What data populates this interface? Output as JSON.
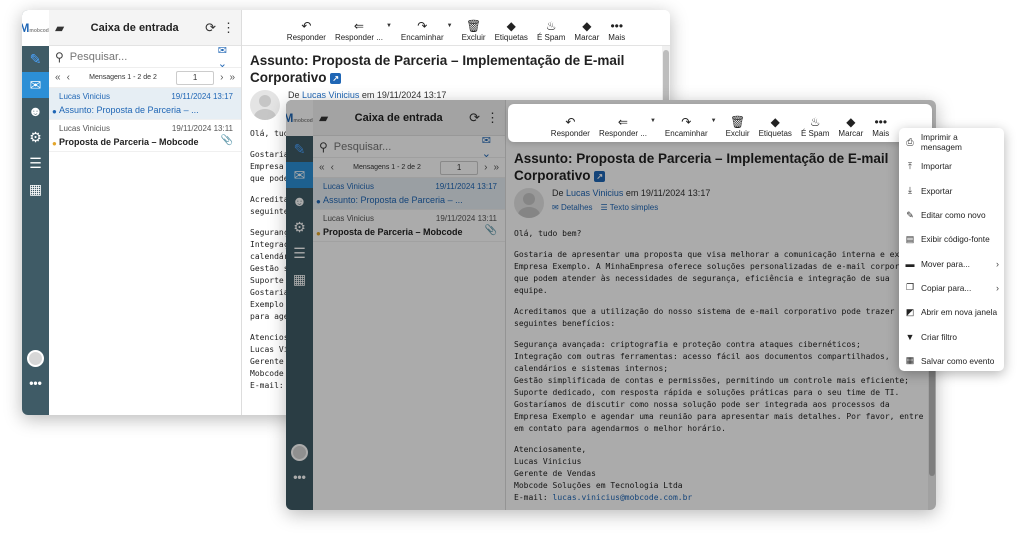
{
  "brand": {
    "logo_text": "M",
    "logo_sub": "mobcode"
  },
  "list": {
    "title": "Caixa de entrada",
    "search_placeholder": "Pesquisar...",
    "pager_label": "Mensagens 1 - 2 de 2",
    "page_number": "1",
    "messages": [
      {
        "sender": "Lucas Vinicius",
        "date": "19/11/2024 13:17",
        "subject": "Assunto: Proposta de Parceria – ...",
        "selected": true,
        "unread_dot": "blue"
      },
      {
        "sender": "Lucas Vinicius",
        "date": "19/11/2024 13:11",
        "subject": "Proposta de Parceria – Mobcode",
        "selected": false,
        "unread_dot": "yellow",
        "attachment": true
      }
    ]
  },
  "toolbar": {
    "reply": "Responder",
    "reply_all": "Responder ...",
    "forward": "Encaminhar",
    "delete": "Excluir",
    "labels": "Etiquetas",
    "spam": "É Spam",
    "mark": "Marcar",
    "more": "Mais"
  },
  "message": {
    "subject": "Assunto: Proposta de Parceria – Implementação de E-mail Corporativo",
    "from_prefix": "De",
    "from_name": "Lucas Vinicius",
    "from_suffix": "em 19/11/2024 13:17",
    "details_link": "Detalhes",
    "plain_text_link": "Texto simples",
    "greeting": "Olá, tudo bem?",
    "para1": "Gostaria de apresentar uma proposta que visa melhorar a comunicação interna e externa Empresa Exemplo. A MinhaEmpresa oferece soluções personalizadas de e-mail corporativo que podem atender às necessidades de segurança, eficiência e integração de sua equipe.",
    "para2": "Acreditamos que a utilização do nosso sistema de e-mail corporativo pode trazer os seguintes benefícios:",
    "benefits": [
      "Segurança avançada: criptografia e proteção contra ataques cibernéticos;",
      "Integração com outras ferramentas: acesso fácil aos documentos compartilhados, calendários e sistemas internos;",
      "Gestão simplificada de contas e permissões, permitindo um controle mais eficiente;",
      "Suporte dedicado, com resposta rápida e soluções práticas para o seu time de TI.",
      "Gostaríamos de discutir como nossa solução pode ser integrada aos processos da Empresa Exemplo e agendar uma reunião para apresentar mais detalhes. Por favor, entre em contato para agendarmos o melhor horário."
    ],
    "signature": [
      "Atenciosamente,",
      "Lucas Vinicius",
      "Gerente de Vendas",
      "Mobcode Soluções em Tecnologia Ltda"
    ],
    "email_label": "E-mail:",
    "email": "lucas.vinicius@mobcode.com.br",
    "back_sig_email": "E-mail:"
  },
  "back_body": {
    "greeting": "Olá, tudo",
    "lines1": [
      "Gostaria",
      "Empresa",
      "que pode"
    ],
    "lines2": [
      "Acreditan",
      "seguinte"
    ],
    "lines3": [
      "Seguranç",
      "Integraç",
      "calendár",
      "Gestão s",
      "Suporte",
      "Gostaria",
      "Exemplo",
      "para age"
    ],
    "sig": [
      "Atencios",
      "Lucas Vi",
      "Gerente",
      "Mobcode",
      "E-mail:"
    ]
  },
  "menu": {
    "items": [
      {
        "label": "Imprimir a mensagem",
        "icon": "print-icon",
        "glyph": "⎙"
      },
      {
        "label": "Importar",
        "icon": "upload-icon",
        "glyph": "⤒"
      },
      {
        "label": "Exportar",
        "icon": "download-icon",
        "glyph": "⤓"
      },
      {
        "label": "Editar como novo",
        "icon": "pencil-icon",
        "glyph": "✎"
      },
      {
        "label": "Exibir código-fonte",
        "icon": "code-file-icon",
        "glyph": "▤"
      },
      {
        "label": "Mover para...",
        "icon": "folder-move-icon",
        "glyph": "▬",
        "submenu": true
      },
      {
        "label": "Copiar para...",
        "icon": "copy-icon",
        "glyph": "❐",
        "submenu": true
      },
      {
        "label": "Abrir em nova janela",
        "icon": "external-window-icon",
        "glyph": "◩"
      },
      {
        "label": "Criar filtro",
        "icon": "filter-icon",
        "glyph": "▼"
      },
      {
        "label": "Salvar como evento",
        "icon": "calendar-icon",
        "glyph": "▦"
      }
    ]
  },
  "colors": {
    "accent": "#1f66b5",
    "rail": "#3f5b66",
    "active_rail": "#2c8fd6"
  }
}
